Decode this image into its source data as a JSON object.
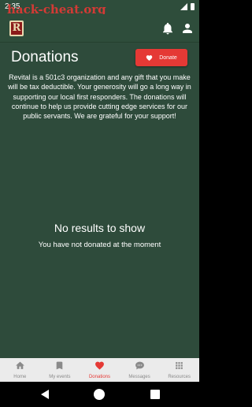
{
  "status_bar": {
    "time": "2:35",
    "watermark": "hack-cheat.org"
  },
  "app_bar": {
    "logo_letter": "R"
  },
  "page": {
    "title": "Donations",
    "donate_button": "Donate",
    "description": "Revital is a 501c3 organization and any gift that you make will be tax deductible. Your generosity will go a long way in supporting our local first responders. The donations will continue to help us provide cutting edge services for our public servants. We are grateful for your support!",
    "empty_title": "No results to show",
    "empty_subtitle": "You have not donated at the moment"
  },
  "bottom_nav": {
    "items": [
      {
        "label": "Home",
        "icon": "home-icon",
        "active": false
      },
      {
        "label": "My events",
        "icon": "bookmark-icon",
        "active": false
      },
      {
        "label": "Donations",
        "icon": "heart-icon",
        "active": true
      },
      {
        "label": "Messages",
        "icon": "chat-bubble-icon",
        "active": false
      },
      {
        "label": "Resources",
        "icon": "grid-icon",
        "active": false
      }
    ]
  },
  "colors": {
    "background": "#2e4b3b",
    "accent": "#e53935",
    "nav_background": "#ebebeb",
    "nav_inactive": "#8a8a8a"
  }
}
